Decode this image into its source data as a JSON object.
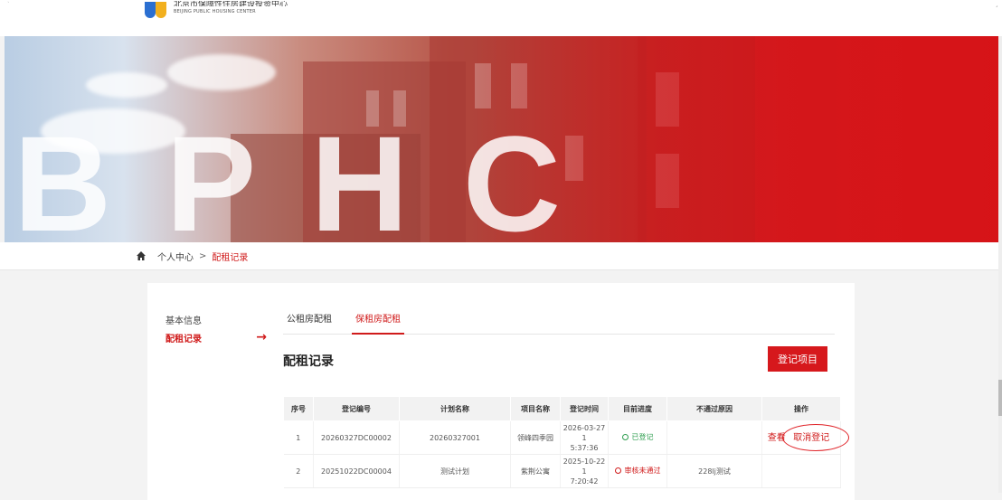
{
  "header": {
    "logo_cn": "北京市保障性住房建设投资中心",
    "logo_en": "BEIJING PUBLIC HOUSING CENTER"
  },
  "banner": {
    "watermark": "BPHC"
  },
  "breadcrumb": {
    "home_icon": "home-icon",
    "parent": "个人中心",
    "separator": ">",
    "current": "配租记录"
  },
  "sidebar": {
    "items": [
      {
        "label": "基本信息",
        "active": false
      },
      {
        "label": "配租记录",
        "active": true,
        "arrow": "→"
      }
    ]
  },
  "tabs": [
    {
      "label": "公租房配租",
      "active": false
    },
    {
      "label": "保租房配租",
      "active": true
    }
  ],
  "main": {
    "title": "配租记录",
    "register_button": "登记项目"
  },
  "table": {
    "headers": [
      "序号",
      "登记编号",
      "计划名称",
      "项目名称",
      "登记时间",
      "目前进度",
      "不通过原因",
      "操作"
    ],
    "rows": [
      {
        "index": "1",
        "reg_no": "20260327DC00002",
        "plan": "20260327001",
        "project": "领峰四季园",
        "time_line1": "2026-03-27 1",
        "time_line2": "5:37:36",
        "status": "已登记",
        "reason": "",
        "op_view": "查看",
        "op_cancel": "取消登记"
      },
      {
        "index": "2",
        "reg_no": "20251022DC00004",
        "plan": "测试计划",
        "project": "紫荆公寓",
        "time_line1": "2025-10-22 1",
        "time_line2": "7:20:42",
        "status": "审核未通过",
        "reason": "228lj测试",
        "op_view": "",
        "op_cancel": ""
      }
    ]
  },
  "colors": {
    "accent": "#d6181c",
    "status_ok": "#2e9e4f",
    "status_fail": "#d01b1b"
  }
}
